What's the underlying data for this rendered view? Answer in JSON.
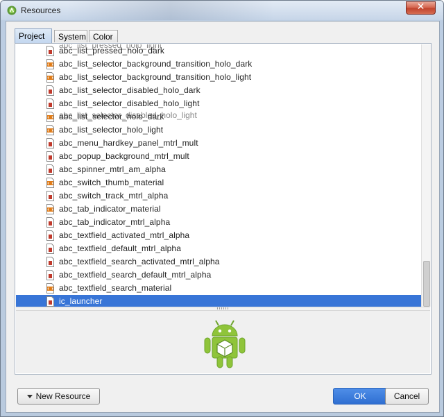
{
  "window": {
    "title": "Resources",
    "close_label": "✕"
  },
  "tabs": [
    {
      "label": "Project",
      "active": true
    },
    {
      "label": "System",
      "active": false
    },
    {
      "label": "Color",
      "active": false
    }
  ],
  "list": {
    "partial_top": "abc_list_pressed_holo_light",
    "items": [
      {
        "label": "abc_list_pressed_holo_dark",
        "icon": "png-icon"
      },
      {
        "label": "abc_list_selector_background_transition_holo_dark",
        "icon": "xml-icon"
      },
      {
        "label": "abc_list_selector_background_transition_holo_light",
        "icon": "xml-icon"
      },
      {
        "label": "abc_list_selector_disabled_holo_dark",
        "icon": "png-icon"
      },
      {
        "label": "abc_list_selector_disabled_holo_light",
        "icon": "png-icon"
      },
      {
        "label": "abc_list_selector_holo_dark",
        "icon": "xml-icon"
      },
      {
        "label": "abc_list_selector_holo_light",
        "icon": "xml-icon"
      },
      {
        "label": "abc_menu_hardkey_panel_mtrl_mult",
        "icon": "png-icon"
      },
      {
        "label": "abc_popup_background_mtrl_mult",
        "icon": "png-icon"
      },
      {
        "label": "abc_spinner_mtrl_am_alpha",
        "icon": "png-icon"
      },
      {
        "label": "abc_switch_thumb_material",
        "icon": "xml-icon"
      },
      {
        "label": "abc_switch_track_mtrl_alpha",
        "icon": "png-icon"
      },
      {
        "label": "abc_tab_indicator_material",
        "icon": "xml-icon"
      },
      {
        "label": "abc_tab_indicator_mtrl_alpha",
        "icon": "png-icon"
      },
      {
        "label": "abc_textfield_activated_mtrl_alpha",
        "icon": "png-icon"
      },
      {
        "label": "abc_textfield_default_mtrl_alpha",
        "icon": "png-icon"
      },
      {
        "label": "abc_textfield_search_activated_mtrl_alpha",
        "icon": "png-icon"
      },
      {
        "label": "abc_textfield_search_default_mtrl_alpha",
        "icon": "png-icon"
      },
      {
        "label": "abc_textfield_search_material",
        "icon": "xml-icon"
      },
      {
        "label": "ic_launcher",
        "icon": "png-icon",
        "selected": true
      }
    ],
    "overlap_ghost": "abc_list_selector_disabled_holo_light"
  },
  "buttons": {
    "new_resource": "New Resource",
    "ok": "OK",
    "cancel": "Cancel"
  },
  "colors": {
    "selection": "#3875d7",
    "ok_button": "#2f6fd1",
    "close_button": "#c0422c",
    "android_green": "#8fc43a"
  }
}
